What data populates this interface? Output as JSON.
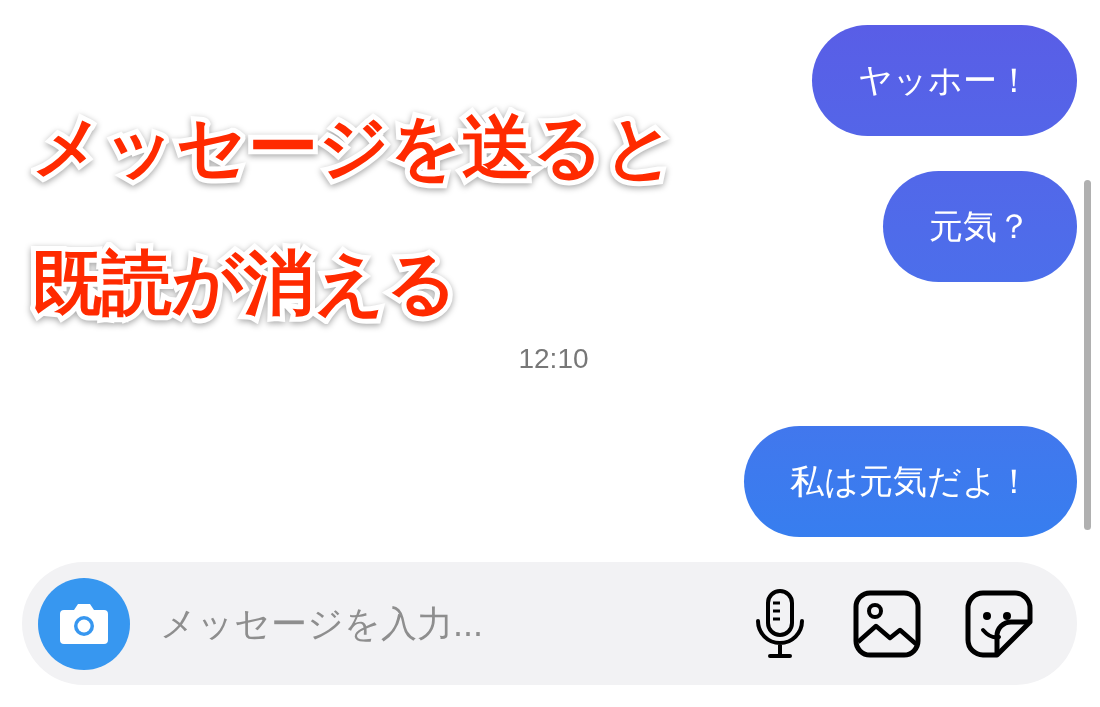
{
  "caption": {
    "lines": [
      "メッセージを送ると",
      "既読が消える"
    ]
  },
  "thread": [
    {
      "kind": "sent",
      "text": "ヤッホー！"
    },
    {
      "kind": "sent",
      "text": "元気？"
    },
    {
      "kind": "timestamp",
      "text": "12:10"
    },
    {
      "kind": "sent",
      "text": "私は元気だよ！"
    }
  ],
  "composer": {
    "placeholder": "メッセージを入力..."
  }
}
